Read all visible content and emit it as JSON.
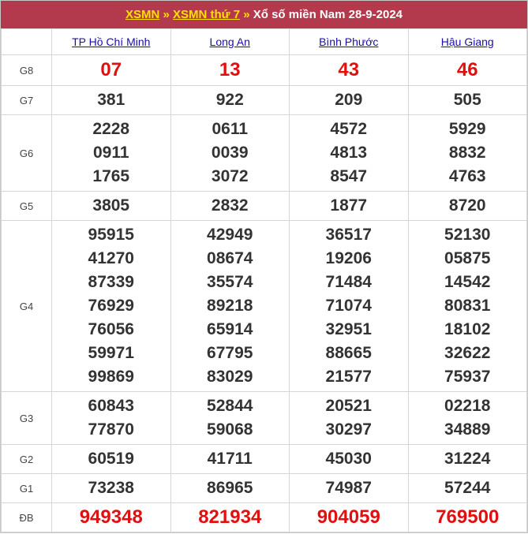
{
  "header": {
    "link_region": "XSMN",
    "sep1": "»",
    "link_day": "XSMN thứ 7",
    "sep2": "»",
    "title_text": "Xổ số miền Nam 28-9-2024"
  },
  "provinces": [
    "TP Hồ Chí Minh",
    "Long An",
    "Bình Phước",
    "Hậu Giang"
  ],
  "prizes": [
    {
      "label": "G8",
      "values": [
        [
          "07"
        ],
        [
          "13"
        ],
        [
          "43"
        ],
        [
          "46"
        ]
      ]
    },
    {
      "label": "G7",
      "values": [
        [
          "381"
        ],
        [
          "922"
        ],
        [
          "209"
        ],
        [
          "505"
        ]
      ]
    },
    {
      "label": "G6",
      "values": [
        [
          "2228",
          "0911",
          "1765"
        ],
        [
          "0611",
          "0039",
          "3072"
        ],
        [
          "4572",
          "4813",
          "8547"
        ],
        [
          "5929",
          "8832",
          "4763"
        ]
      ]
    },
    {
      "label": "G5",
      "values": [
        [
          "3805"
        ],
        [
          "2832"
        ],
        [
          "1877"
        ],
        [
          "8720"
        ]
      ]
    },
    {
      "label": "G4",
      "values": [
        [
          "95915",
          "41270",
          "87339",
          "76929",
          "76056",
          "59971",
          "99869"
        ],
        [
          "42949",
          "08674",
          "35574",
          "89218",
          "65914",
          "67795",
          "83029"
        ],
        [
          "36517",
          "19206",
          "71484",
          "71074",
          "32951",
          "88665",
          "21577"
        ],
        [
          "52130",
          "05875",
          "14542",
          "80831",
          "18102",
          "32622",
          "75937"
        ]
      ]
    },
    {
      "label": "G3",
      "values": [
        [
          "60843",
          "77870"
        ],
        [
          "52844",
          "59068"
        ],
        [
          "20521",
          "30297"
        ],
        [
          "02218",
          "34889"
        ]
      ]
    },
    {
      "label": "G2",
      "values": [
        [
          "60519"
        ],
        [
          "41711"
        ],
        [
          "45030"
        ],
        [
          "31224"
        ]
      ]
    },
    {
      "label": "G1",
      "values": [
        [
          "73238"
        ],
        [
          "86965"
        ],
        [
          "74987"
        ],
        [
          "57244"
        ]
      ]
    },
    {
      "label": "ĐB",
      "values": [
        [
          "949348"
        ],
        [
          "821934"
        ],
        [
          "904059"
        ],
        [
          "769500"
        ]
      ]
    }
  ]
}
